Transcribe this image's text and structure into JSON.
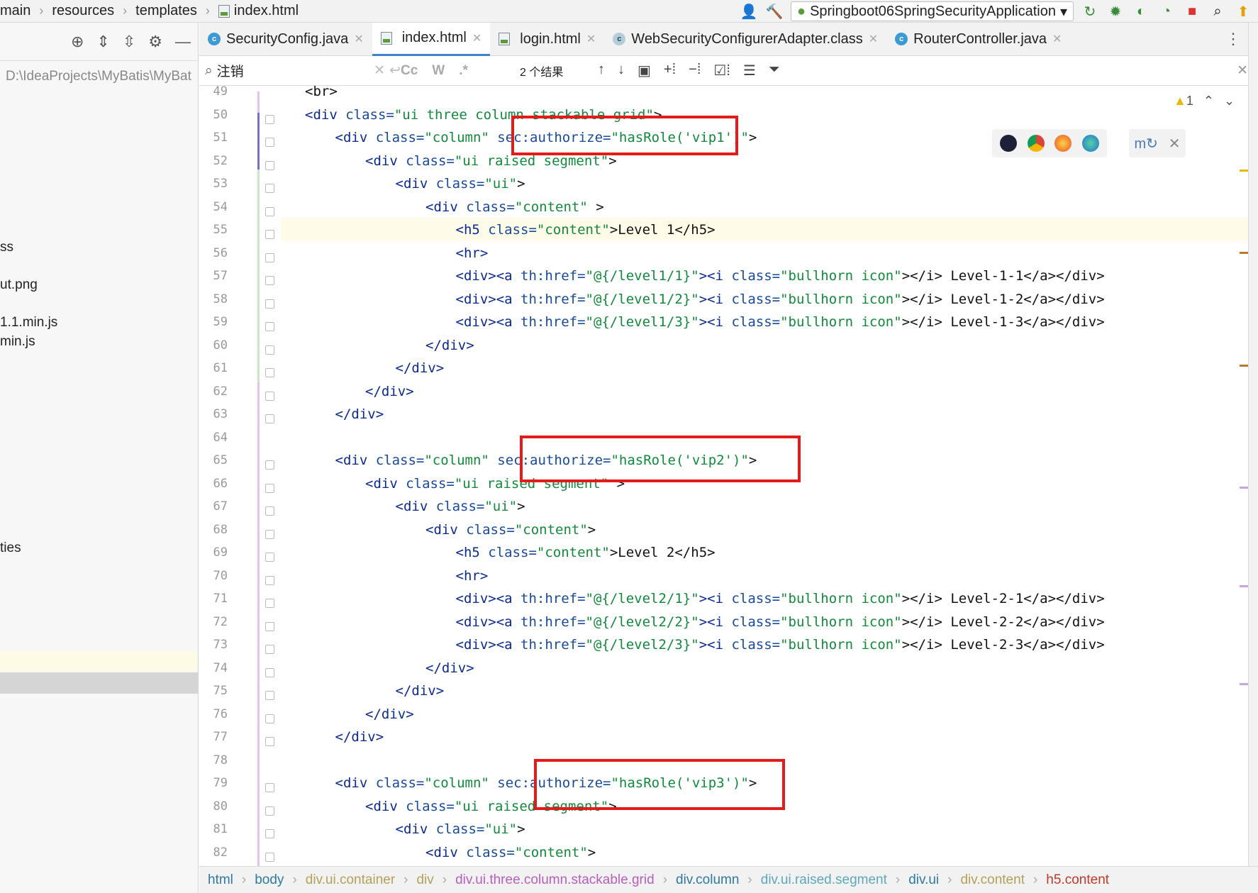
{
  "titlebar": {
    "breadcrumb": [
      "main",
      "resources",
      "templates",
      "index.html"
    ],
    "run_config": "Springboot06SpringSecurityApplication"
  },
  "sidebar": {
    "path": "D:\\IdeaProjects\\MyBatis\\MyBat",
    "fragments": [
      "ss",
      "ut.png",
      "1.1.min.js",
      "min.js",
      "ties"
    ]
  },
  "tabs": [
    {
      "label": "SecurityConfig.java",
      "icon": "class-icon"
    },
    {
      "label": "index.html",
      "icon": "html-file-icon",
      "active": true
    },
    {
      "label": "login.html",
      "icon": "html-file-icon"
    },
    {
      "label": "WebSecurityConfigurerAdapter.class",
      "icon": "locked-class-icon"
    },
    {
      "label": "RouterController.java",
      "icon": "class-icon"
    }
  ],
  "find": {
    "query": "注销",
    "result": "2 个结果",
    "opt_case": "Cc",
    "opt_word": "W",
    "opt_regex": ".*"
  },
  "editor": {
    "warning_count": "1",
    "line_numbers": [
      "49",
      "50",
      "51",
      "52",
      "53",
      "54",
      "55",
      "56",
      "57",
      "58",
      "59",
      "60",
      "61",
      "62",
      "63",
      "64",
      "65",
      "66",
      "67",
      "68",
      "69",
      "70",
      "71",
      "72",
      "73",
      "74",
      "75",
      "76",
      "77",
      "78",
      "79",
      "80",
      "81",
      "82"
    ]
  },
  "code": {
    "l49": "<br>",
    "l50_t": "<div",
    "l50_a": " class=",
    "l50_v": "\"ui three column stackable grid\"",
    "l50_e": ">",
    "l51_t": "<div",
    "l51_a": " class=",
    "l51_v": "\"column\"",
    "l51_a2": " sec:authorize=",
    "l51_v2": "\"hasRole('vip1')\"",
    "l51_e": ">",
    "l52_t": "<div",
    "l52_a": " class=",
    "l52_v": "\"ui raised segment\"",
    "l52_e": ">",
    "l53_t": "<div",
    "l53_a": " class=",
    "l53_v": "\"ui\"",
    "l53_e": ">",
    "l54_t": "<div",
    "l54_a": " class=",
    "l54_v": "\"content\"",
    "l54_e": " >",
    "l55_t": "<h5",
    "l55_a": " class=",
    "l55_v": "\"content\"",
    "l55_x": ">Level 1</h5>",
    "l56": "<hr>",
    "l57_a": "<div><a",
    "l57_b": " th:href=",
    "l57_c": "\"@{/level1/1}\"",
    "l57_d": "><i",
    "l57_e": " class=",
    "l57_f": "\"bullhorn icon\"",
    "l57_g": "></i> Level-1-1</a></div>",
    "l58_c": "\"@{/level1/2}\"",
    "l58_g": "></i> Level-1-2</a></div>",
    "l59_c": "\"@{/level1/3}\"",
    "l59_g": "></i> Level-1-3</a></div>",
    "l60": "</div>",
    "l61": "</div>",
    "l62": "</div>",
    "l63": "</div>",
    "l65_v2": "\"hasRole('vip2')\"",
    "l66_v": "\"ui raised segment\"",
    "l66_e": " >",
    "l68_e": ">",
    "l69_x": ">Level 2</h5>",
    "l71_c": "\"@{/level2/1}\"",
    "l71_g": "></i> Level-2-1</a></div>",
    "l72_c": "\"@{/level2/2}\"",
    "l72_g": "></i> Level-2-2</a></div>",
    "l73_c": "\"@{/level2/3}\"",
    "l73_g": "></i> Level-2-3</a></div>",
    "l79_v2": "\"hasRole('vip3')\"",
    "l80_v": "\"ui raised segment\"",
    "l82_t": "<div",
    "l82_a": " class=",
    "l82_v": "\"content\"",
    "l82_e": ">"
  },
  "statusbar": {
    "path": [
      "html",
      "body",
      "div.ui.container",
      "div",
      "div.ui.three.column.stackable.grid",
      "div.column",
      "div.ui.raised.segment",
      "div.ui",
      "div.content",
      "h5.content"
    ]
  },
  "colors": {
    "highlight_box": "#e31b1b",
    "active_tab_underline": "#4083c9",
    "current_line": "#fefbe8"
  }
}
